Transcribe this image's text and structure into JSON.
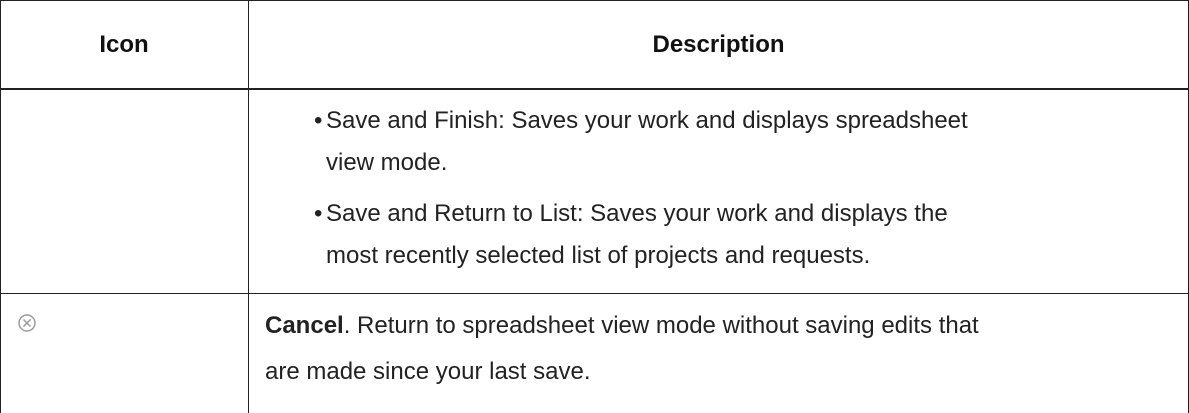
{
  "table": {
    "headers": {
      "icon": "Icon",
      "description": "Description"
    },
    "rows": [
      {
        "icon": "",
        "bullets": [
          {
            "line1": "Save and Finish: Saves your work and displays spreadsheet",
            "line2": "view mode."
          },
          {
            "line1": "Save and Return to List: Saves your work and displays the",
            "line2": "most recently selected list of projects and requests."
          }
        ]
      },
      {
        "icon": "cancel-circle-x-icon",
        "title": "Cancel",
        "desc_line1_rest": ". Return to spreadsheet view mode without saving edits that",
        "desc_line2": "are made since your last save."
      }
    ]
  },
  "colors": {
    "border": "#222222",
    "text": "#222222",
    "icon": "#9a9a9a"
  }
}
